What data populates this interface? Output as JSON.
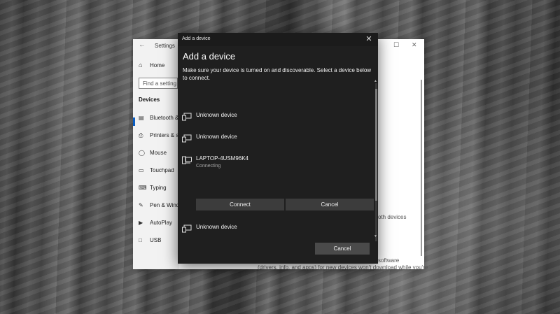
{
  "settings": {
    "title": "Settings",
    "home_label": "Home",
    "search_placeholder": "Find a setting",
    "section_title": "Devices",
    "nav": [
      {
        "label": "Bluetooth & other devices",
        "icon": "bluetooth-icon",
        "active": true
      },
      {
        "label": "Printers & scanners",
        "icon": "printer-icon"
      },
      {
        "label": "Mouse",
        "icon": "mouse-icon"
      },
      {
        "label": "Touchpad",
        "icon": "touchpad-icon"
      },
      {
        "label": "Typing",
        "icon": "keyboard-icon"
      },
      {
        "label": "Pen & Windows Ink",
        "icon": "pen-icon"
      },
      {
        "label": "AutoPlay",
        "icon": "autoplay-icon"
      },
      {
        "label": "USB",
        "icon": "usb-icon"
      }
    ],
    "bg_text_1": "oth devices",
    "bg_text_2": "software",
    "bg_text_3": "(drivers, info, and apps) for new devices won't download while you're"
  },
  "dialog": {
    "title_bar": "Add a device",
    "heading": "Add a device",
    "description": "Make sure your device is turned on and discoverable. Select a device below to connect.",
    "devices": [
      {
        "name": "Unknown device",
        "status": "",
        "icon": "display-device-icon"
      },
      {
        "name": "Unknown device",
        "status": "",
        "icon": "display-device-icon"
      },
      {
        "name": "LAPTOP-4USM96K4",
        "status": "Connecting",
        "icon": "computer-device-icon"
      },
      {
        "name": "Unknown device",
        "status": "",
        "icon": "display-device-icon"
      }
    ],
    "connect_label": "Connect",
    "cancel_inline_label": "Cancel",
    "cancel_label": "Cancel"
  }
}
